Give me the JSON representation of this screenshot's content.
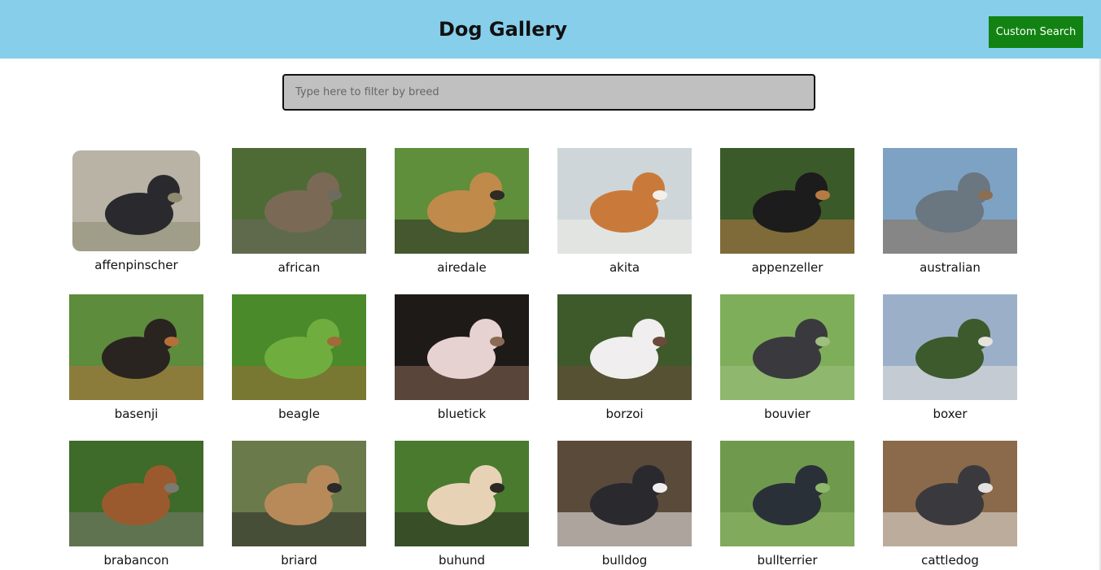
{
  "header": {
    "title": "Dog Gallery",
    "custom_search_label": "Custom Search",
    "background": "#87ceeb",
    "button_color": "#128312"
  },
  "search": {
    "placeholder": "Type here to filter by breed",
    "value": ""
  },
  "breeds": [
    {
      "name": "affenpinscher",
      "colors": [
        "#b9b3a6",
        "#2a2a2e",
        "#8d8a70"
      ]
    },
    {
      "name": "african",
      "colors": [
        "#4f6b35",
        "#7a6a55",
        "#6d6a60"
      ]
    },
    {
      "name": "airedale",
      "colors": [
        "#5f8f3a",
        "#c08a4a",
        "#2e2a24"
      ]
    },
    {
      "name": "akita",
      "colors": [
        "#cfd6d9",
        "#c97a3a",
        "#f2f0ea"
      ]
    },
    {
      "name": "appenzeller",
      "colors": [
        "#3b5a2a",
        "#1c1c1c",
        "#b87a45"
      ]
    },
    {
      "name": "australian",
      "colors": [
        "#7ea2c4",
        "#6a7680",
        "#8a6f52"
      ]
    },
    {
      "name": "basenji",
      "colors": [
        "#5c8c3c",
        "#2a2420",
        "#b5703a"
      ]
    },
    {
      "name": "beagle",
      "colors": [
        "#4a8a2a",
        "#6fae3e",
        "#a06a3a"
      ]
    },
    {
      "name": "bluetick",
      "colors": [
        "#1e1a18",
        "#e6d2d0",
        "#8a6a55"
      ]
    },
    {
      "name": "borzoi",
      "colors": [
        "#3e5a2a",
        "#f0eeee",
        "#6a4a3a"
      ]
    },
    {
      "name": "bouvier",
      "colors": [
        "#7fae5a",
        "#3a3a3e",
        "#9fbf7f"
      ]
    },
    {
      "name": "boxer",
      "colors": [
        "#9bb0c8",
        "#3c5a2c",
        "#e6e2dc"
      ]
    },
    {
      "name": "brabancon",
      "colors": [
        "#3e6a2a",
        "#9a5a2e",
        "#7a7a70"
      ]
    },
    {
      "name": "briard",
      "colors": [
        "#6a7a4a",
        "#b88a5a",
        "#2a2a2a"
      ]
    },
    {
      "name": "buhund",
      "colors": [
        "#4a7a2e",
        "#e8d2b6",
        "#2a2a22"
      ]
    },
    {
      "name": "bulldog",
      "colors": [
        "#5a4a3a",
        "#2a2a2e",
        "#f0eeee"
      ]
    },
    {
      "name": "bullterrier",
      "colors": [
        "#6f9a4e",
        "#2a3038",
        "#8fb86a"
      ]
    },
    {
      "name": "cattledog",
      "colors": [
        "#8a6a4a",
        "#3a3a3e",
        "#e4e2de"
      ]
    }
  ]
}
